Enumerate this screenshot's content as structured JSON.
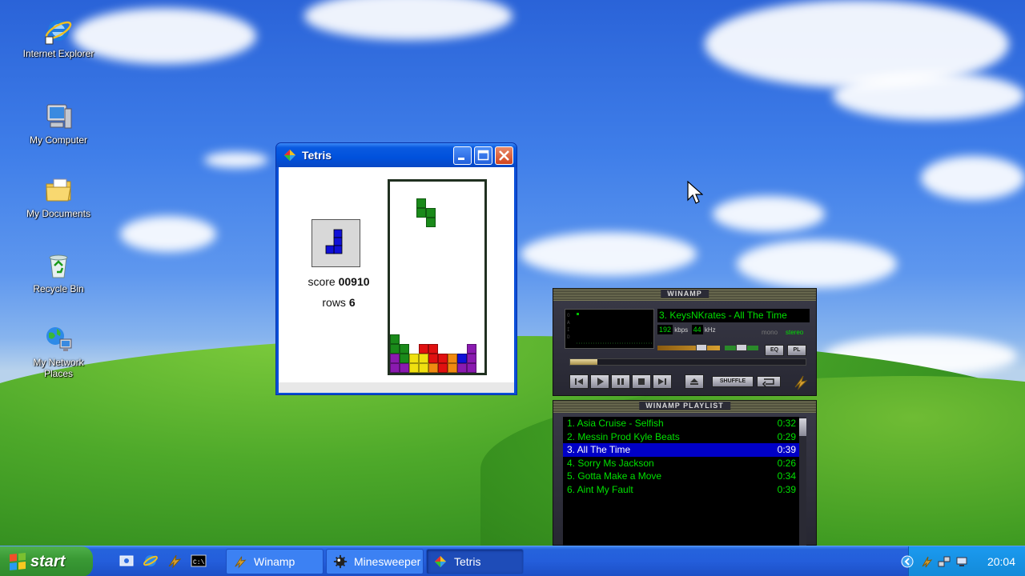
{
  "desktop": {
    "icons": [
      {
        "label": "Internet Explorer",
        "icon": "internet-explorer-icon"
      },
      {
        "label": "My Computer",
        "icon": "my-computer-icon"
      },
      {
        "label": "My Documents",
        "icon": "my-documents-icon"
      },
      {
        "label": "Recycle Bin",
        "icon": "recycle-bin-icon"
      },
      {
        "label": "My Network Places",
        "icon": "network-places-icon"
      }
    ]
  },
  "tetris": {
    "title": "Tetris",
    "score_label": "score",
    "score_value": "00910",
    "rows_label": "rows",
    "rows_value": "6",
    "colors": {
      "green": "#1a8a1a",
      "red": "#e01010",
      "yellow": "#f0e010",
      "orange": "#f08a10",
      "purple": "#8a1ab0",
      "blue": "#1010d8"
    }
  },
  "winamp": {
    "title": "WINAMP",
    "track_display": "3. KeysNKrates - All The Time",
    "kbps": "192",
    "kbps_label": "kbps",
    "khz": "44",
    "khz_label": "kHz",
    "mono_label": "mono",
    "stereo_label": "stereo",
    "eq_label": "EQ",
    "pl_label": "PL",
    "shuffle_label": "SHUFFLE",
    "playlist_title": "WINAMP PLAYLIST",
    "playlist": [
      {
        "title": "1. Asia Cruise - Selfish",
        "duration": "0:32"
      },
      {
        "title": "2. Messin Prod Kyle Beats",
        "duration": "0:29"
      },
      {
        "title": "3. All The Time",
        "duration": "0:39"
      },
      {
        "title": "4. Sorry Ms Jackson",
        "duration": "0:26"
      },
      {
        "title": "5. Gotta Make a Move",
        "duration": "0:34"
      },
      {
        "title": "6. Aint My Fault",
        "duration": "0:39"
      }
    ],
    "active_index": 2,
    "accent": "#00e000"
  },
  "taskbar": {
    "start_label": "start",
    "tasks": [
      {
        "label": "Winamp",
        "icon": "winamp-icon"
      },
      {
        "label": "Minesweeper",
        "icon": "minesweeper-icon"
      },
      {
        "label": "Tetris",
        "icon": "tetris-icon"
      }
    ],
    "active_task": "Tetris",
    "clock": "20:04"
  }
}
